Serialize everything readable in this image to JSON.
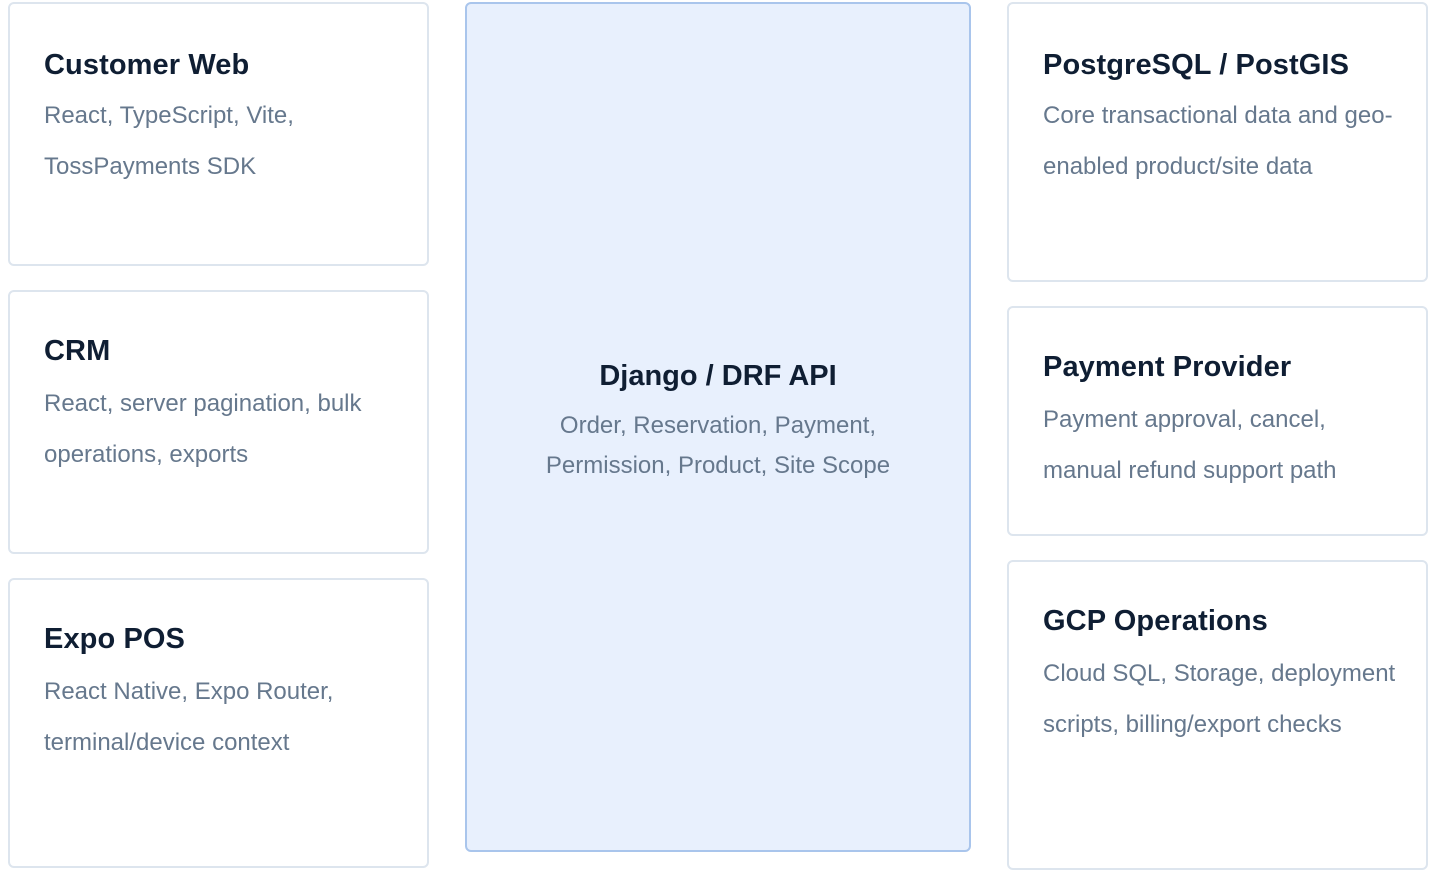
{
  "clients": [
    {
      "title": "Customer Web",
      "desc": "React, TypeScript, Vite, TossPayments SDK"
    },
    {
      "title": "CRM",
      "desc": "React, server pagination, bulk operations, exports"
    },
    {
      "title": "Expo POS",
      "desc": "React Native, Expo Router, terminal/device context"
    }
  ],
  "api": {
    "title": "Django / DRF API",
    "desc": "Order, Reservation, Payment, Permission, Product, Site Scope"
  },
  "services": [
    {
      "title": "PostgreSQL / PostGIS",
      "desc": "Core transactional data and geo-enabled product/site data"
    },
    {
      "title": "Payment Provider",
      "desc": "Payment approval, cancel, manual refund support path"
    },
    {
      "title": "GCP Operations",
      "desc": "Cloud SQL, Storage, deployment scripts, billing/export checks"
    }
  ]
}
